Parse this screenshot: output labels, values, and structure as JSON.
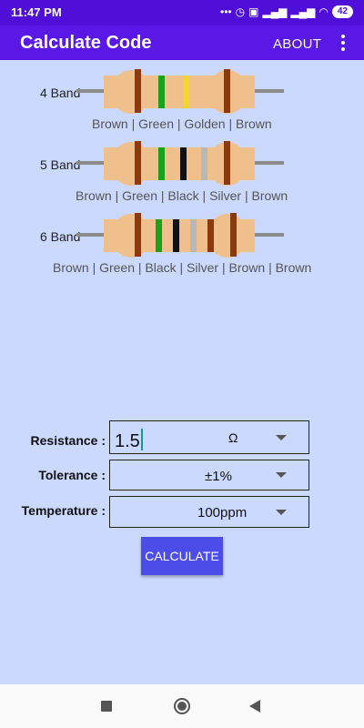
{
  "status_bar": {
    "time": "11:47 PM",
    "icons": [
      "dots-icon",
      "alarm-icon",
      "data-icon",
      "signal-icon",
      "signal-icon",
      "wifi-icon"
    ],
    "battery": "42"
  },
  "app_bar": {
    "title": "Calculate Code",
    "about_label": "ABOUT",
    "menu_icon": "more-vert-icon"
  },
  "resistors": [
    {
      "label": "4 Band",
      "colors_text": "Brown | Green | Golden | Brown"
    },
    {
      "label": "5 Band",
      "colors_text": "Brown | Green | Black | Silver | Brown"
    },
    {
      "label": "6 Band",
      "colors_text": "Brown | Green | Black | Silver | Brown | Brown"
    }
  ],
  "form": {
    "resistance_label": "Resistance :",
    "resistance_value": "1.5",
    "resistance_unit": "Ω",
    "tolerance_label": "Tolerance :",
    "tolerance_value": "±1%",
    "temperature_label": "Temperature :",
    "temperature_value": "100ppm"
  },
  "calculate_label": "CALCULATE",
  "colors": {
    "app_bar": "#5a18e6",
    "background": "#ccd9ff",
    "button": "#4c4ce8",
    "resistor_body": "#f0c08c",
    "brown": "#8b3a0e",
    "green": "#1aa01a",
    "golden": "#f2d630",
    "black": "#111111",
    "silver": "#b8b8b8"
  }
}
